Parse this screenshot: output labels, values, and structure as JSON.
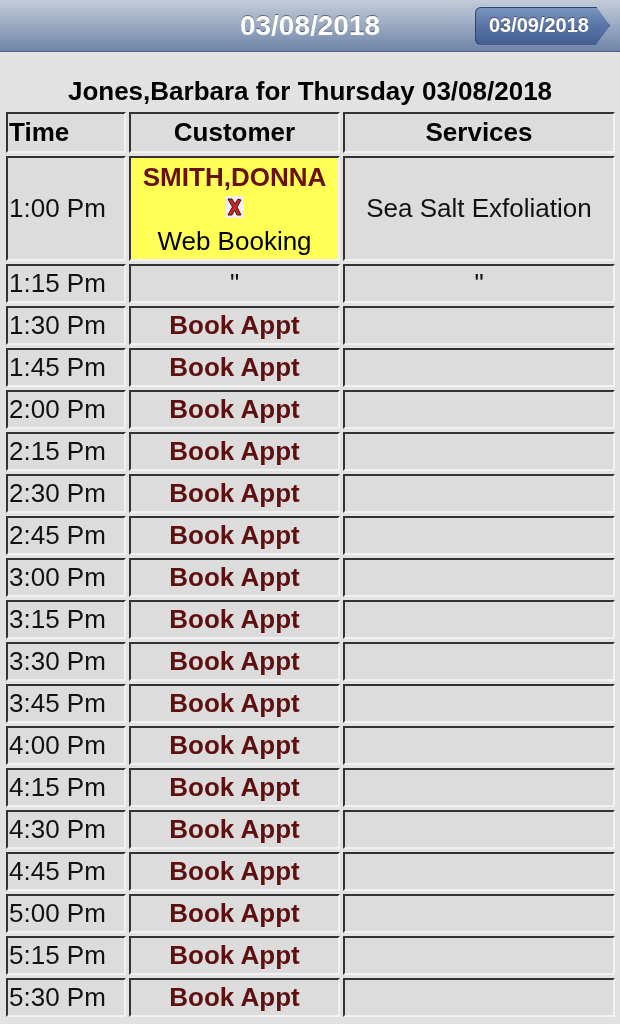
{
  "header": {
    "title": "03/08/2018",
    "next_button": "03/09/2018"
  },
  "heading": "Jones,Barbara for Thursday 03/08/2018",
  "table": {
    "columns": [
      "Time",
      "Customer",
      "Services"
    ],
    "rows": [
      {
        "time": "1:00 Pm",
        "kind": "booking",
        "customer": "SMITH,DONNA",
        "source": "Web Booking",
        "service": "Sea Salt Exfoliation"
      },
      {
        "time": "1:15 Pm",
        "kind": "continued",
        "customer": "\"",
        "service": "\""
      },
      {
        "time": "1:30 Pm",
        "kind": "open",
        "action": "Book Appt"
      },
      {
        "time": "1:45 Pm",
        "kind": "open",
        "action": "Book Appt"
      },
      {
        "time": "2:00 Pm",
        "kind": "open",
        "action": "Book Appt"
      },
      {
        "time": "2:15 Pm",
        "kind": "open",
        "action": "Book Appt"
      },
      {
        "time": "2:30 Pm",
        "kind": "open",
        "action": "Book Appt"
      },
      {
        "time": "2:45 Pm",
        "kind": "open",
        "action": "Book Appt"
      },
      {
        "time": "3:00 Pm",
        "kind": "open",
        "action": "Book Appt"
      },
      {
        "time": "3:15 Pm",
        "kind": "open",
        "action": "Book Appt"
      },
      {
        "time": "3:30 Pm",
        "kind": "open",
        "action": "Book Appt"
      },
      {
        "time": "3:45 Pm",
        "kind": "open",
        "action": "Book Appt"
      },
      {
        "time": "4:00 Pm",
        "kind": "open",
        "action": "Book Appt"
      },
      {
        "time": "4:15 Pm",
        "kind": "open",
        "action": "Book Appt"
      },
      {
        "time": "4:30 Pm",
        "kind": "open",
        "action": "Book Appt"
      },
      {
        "time": "4:45 Pm",
        "kind": "open",
        "action": "Book Appt"
      },
      {
        "time": "5:00 Pm",
        "kind": "open",
        "action": "Book Appt"
      },
      {
        "time": "5:15 Pm",
        "kind": "open",
        "action": "Book Appt"
      },
      {
        "time": "5:30 Pm",
        "kind": "open",
        "action": "Book Appt"
      }
    ]
  }
}
